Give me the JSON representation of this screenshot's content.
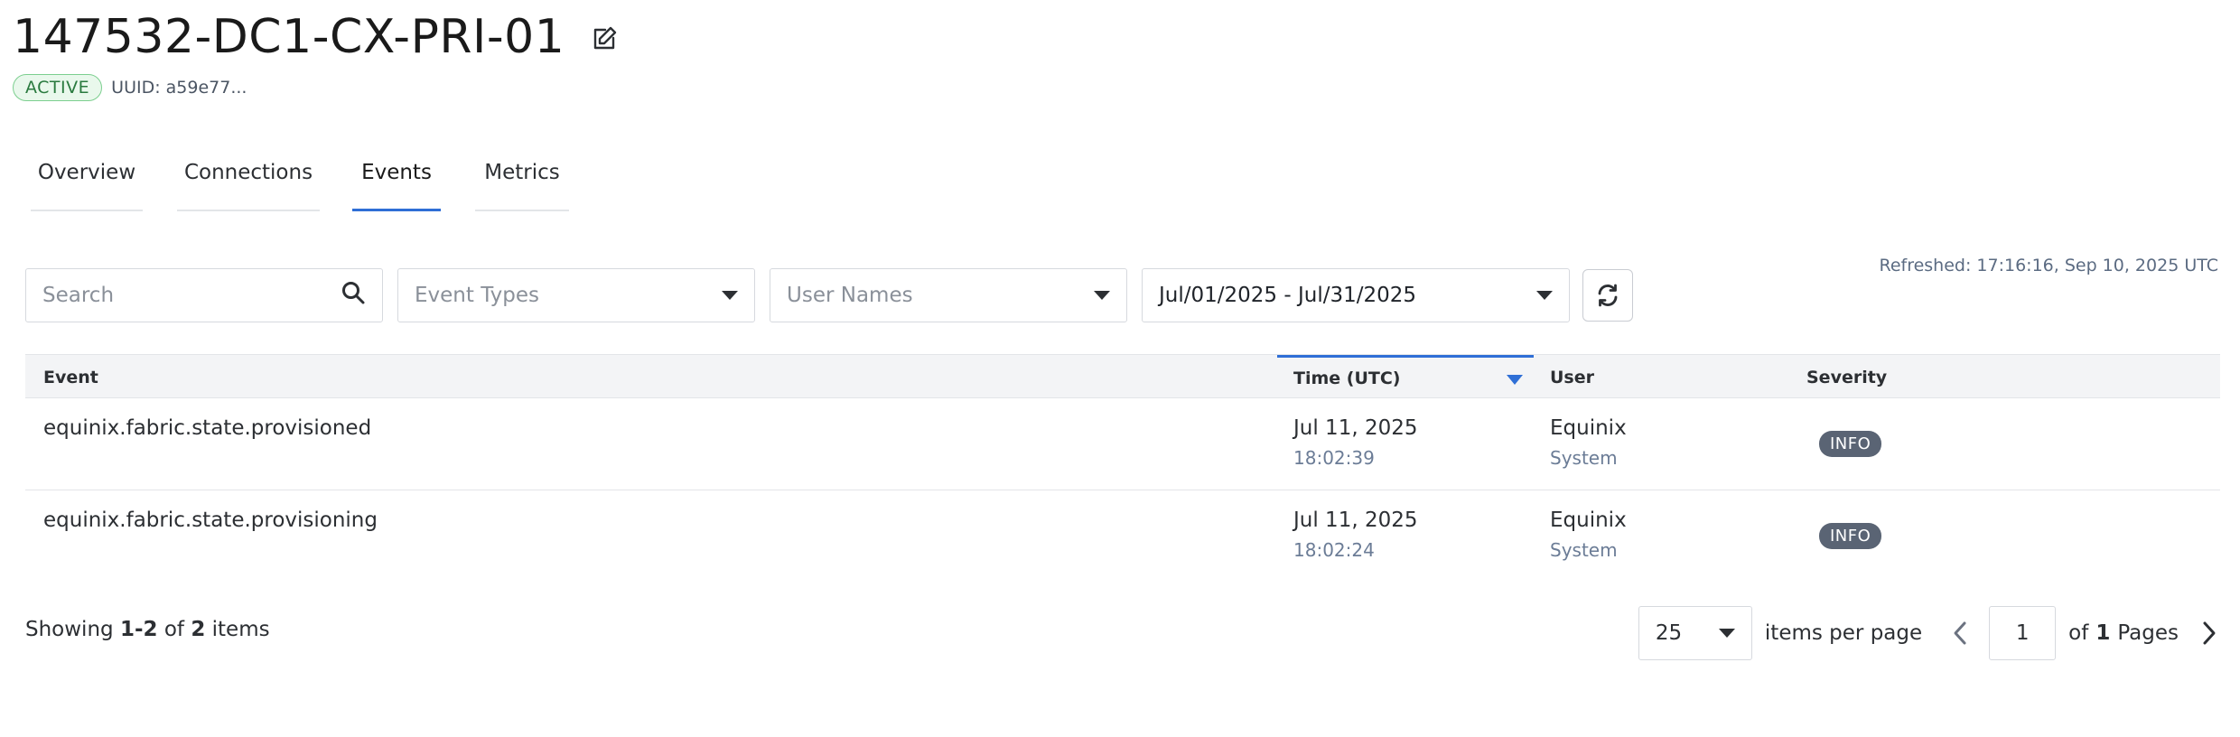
{
  "header": {
    "title": "147532-DC1-CX-PRI-01",
    "status": "ACTIVE",
    "uuid": "UUID: a59e77..."
  },
  "tabs": [
    {
      "label": "Overview",
      "active": false
    },
    {
      "label": "Connections",
      "active": false
    },
    {
      "label": "Events",
      "active": true
    },
    {
      "label": "Metrics",
      "active": false
    }
  ],
  "filters": {
    "search_placeholder": "Search",
    "event_types_placeholder": "Event Types",
    "user_names_placeholder": "User Names",
    "date_range": "Jul/01/2025 - Jul/31/2025"
  },
  "refreshed": "Refreshed:  17:16:16, Sep 10, 2025 UTC",
  "table": {
    "columns": [
      "Event",
      "Time (UTC)",
      "User",
      "Severity"
    ],
    "sorted_column": "Time (UTC)",
    "rows": [
      {
        "event": "equinix.fabric.state.provisioned",
        "date": "Jul 11, 2025",
        "time": "18:02:39",
        "user": "Equinix",
        "user_type": "System",
        "severity": "INFO"
      },
      {
        "event": "equinix.fabric.state.provisioning",
        "date": "Jul 11, 2025",
        "time": "18:02:24",
        "user": "Equinix",
        "user_type": "System",
        "severity": "INFO"
      }
    ]
  },
  "footer": {
    "showing_prefix": "Showing",
    "range": "1-2",
    "of_word": "of",
    "total": "2",
    "items_word": "items"
  },
  "pagination": {
    "per_page": "25",
    "per_page_label": "items per page",
    "current_page": "1",
    "of_word": "of",
    "total_pages": "1",
    "pages_word": "Pages"
  },
  "colors": {
    "accent": "#2f6fd6",
    "active_badge_bg": "#e9f8ec",
    "active_badge_border": "#7ccf8f",
    "severity_badge": "#5a6474"
  }
}
